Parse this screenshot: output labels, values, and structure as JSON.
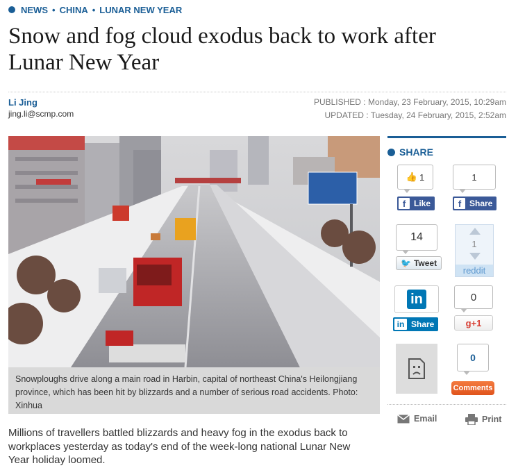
{
  "breadcrumb": {
    "items": [
      "NEWS",
      "CHINA",
      "LUNAR NEW YEAR"
    ],
    "separator": "•"
  },
  "article": {
    "title": "Snow and fog cloud exodus back to work after Lunar New Year",
    "author_name": "Li Jing",
    "author_email": "jing.li@scmp.com",
    "published_label": "PUBLISHED :",
    "published_value": "Monday, 23 February, 2015, 10:29am",
    "updated_label": "UPDATED :",
    "updated_value": "Tuesday, 24 February, 2015, 2:52am",
    "caption": "Snowploughs drive along a main road in Harbin, capital of northeast China's Heilongjiang province, which has been hit by blizzards and a number of serious road accidents. Photo: Xinhua",
    "body_first": "Millions of travellers battled blizzards and heavy fog in the exodus back to workplaces yesterday as today's end of the week-long national Lunar New Year holiday loomed."
  },
  "share": {
    "title": "SHARE",
    "fb_like_count": "1",
    "fb_like_label": "Like",
    "fb_share_count": "1",
    "fb_share_label": "Share",
    "tweet_count": "14",
    "tweet_label": "Tweet",
    "reddit_count": "1",
    "reddit_label": "reddit",
    "linkedin_label": "Share",
    "gplus_count": "0",
    "gplus_label": "g+1",
    "comments_count": "0",
    "comments_label": "Comments",
    "email_label": "Email",
    "print_label": "Print"
  },
  "colors": {
    "accent": "#1a5e96",
    "facebook": "#3b5998",
    "linkedin": "#0077b5",
    "comments": "#e8612a"
  }
}
